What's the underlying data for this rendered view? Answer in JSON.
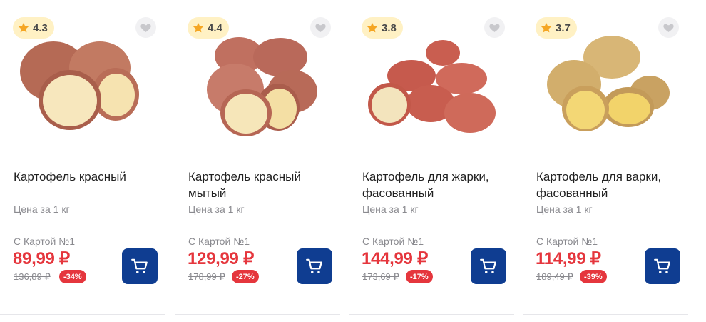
{
  "colors": {
    "accent_red": "#e5363d",
    "cart_blue": "#0f3d91",
    "rating_bg": "#fff1c4",
    "star": "#f5a623"
  },
  "products": [
    {
      "rating": "4.3",
      "name": "Картофель красный",
      "unit": "Цена за 1 кг",
      "card_label": "С Картой №1",
      "price": "89,99 ₽",
      "old_price": "136,89 ₽",
      "discount": "-34%"
    },
    {
      "rating": "4.4",
      "name": "Картофель красный мытый",
      "unit": "Цена за 1 кг",
      "card_label": "С Картой №1",
      "price": "129,99 ₽",
      "old_price": "178,99 ₽",
      "discount": "-27%"
    },
    {
      "rating": "3.8",
      "name": "Картофель для жарки, фасованный",
      "unit": "Цена за 1 кг",
      "card_label": "С Картой №1",
      "price": "144,99 ₽",
      "old_price": "173,69 ₽",
      "discount": "-17%"
    },
    {
      "rating": "3.7",
      "name": "Картофель для варки, фасованный",
      "unit": "Цена за 1 кг",
      "card_label": "С Картой №1",
      "price": "114,99 ₽",
      "old_price": "189,49 ₽",
      "discount": "-39%"
    }
  ],
  "icons": {
    "rating": "star-icon",
    "favorite": "heart-icon",
    "cart": "cart-icon"
  }
}
